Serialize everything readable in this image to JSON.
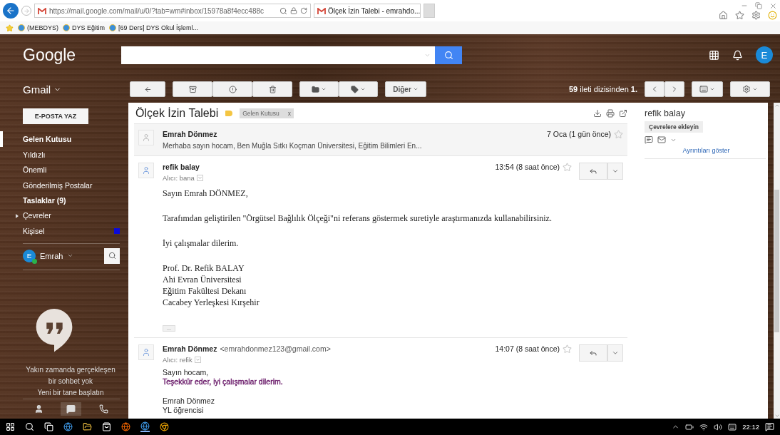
{
  "browser": {
    "url": "https://mail.google.com/mail/u/0/?tab=wm#inbox/15978a8f4ecc488c",
    "tab_title": "Ölçek İzin Talebi - emrahdo...",
    "favorites": [
      "(MEBDYS)",
      "DYS Eğitim",
      "[69 Ders] DYS Okul İşleml..."
    ]
  },
  "header": {
    "logo": "Google",
    "avatar": "E"
  },
  "toolbar": {
    "app_label": "Gmail",
    "more": "Diğer",
    "count": "**59** ileti dizisinden **1.**"
  },
  "sidebar": {
    "compose": "E-POSTA YAZ",
    "items": [
      {
        "label": "Gelen Kutusu",
        "selected": true,
        "bold": true,
        "kind": "folder"
      },
      {
        "label": "Yıldızlı",
        "selected": false,
        "bold": false,
        "kind": "folder"
      },
      {
        "label": "Önemli",
        "selected": false,
        "bold": false,
        "kind": "folder"
      },
      {
        "label": "Gönderilmiş Postalar",
        "selected": false,
        "bold": false,
        "kind": "folder"
      },
      {
        "label": "Taslaklar (9)",
        "selected": false,
        "bold": true,
        "kind": "folder"
      },
      {
        "label": "Çevreler",
        "selected": false,
        "bold": false,
        "kind": "group",
        "expanded": false
      },
      {
        "label": "Kişisel",
        "selected": false,
        "bold": false,
        "kind": "label",
        "color": "#0a0ad8"
      }
    ],
    "user": {
      "avatar": "E",
      "name": "Emrah",
      "online": true
    },
    "hangouts": [
      "Yakın zamanda gerçekleşen",
      "bir sohbet yok",
      "Yeni bir tane başlatın"
    ]
  },
  "thread": {
    "subject": "Ölçek İzin Talebi",
    "labels": [
      {
        "name": "Gelen Kutusu",
        "remove": "x"
      }
    ],
    "messages": [
      {
        "kind": "collapsed",
        "sender": "Emrah Dönmez",
        "date": "7 Oca (1 gün önce)",
        "starred": false,
        "snippet": "Merhaba sayın hocam, Ben Muğla Sıtkı Koçman Üniversitesi, Eğitim Bilimleri En..."
      },
      {
        "kind": "formatted",
        "sender": "refik balay",
        "recipient": "Alıcı: bana",
        "date": "13:54 (8 saat önce)",
        "starred": false,
        "trimmed": "...",
        "paragraphs": [
          {
            "lines": [
              {
                "text": "Sayın Emrah DÖNMEZ,"
              }
            ]
          },
          {
            "lines": [
              {
                "text": "Tarafımdan geliştirilen \"Örgütsel Bağlılık Ölçeği\"ni referans göstermek suretiyle araştırmanızda kullanabilirsiniz."
              }
            ]
          },
          {
            "lines": [
              {
                "text": "İyi çalışmalar dilerim."
              }
            ]
          },
          {
            "lines": [
              {
                "text": "Prof. Dr. Refik BALAY"
              },
              {
                "text": "Ahi Evran Üniversitesi"
              },
              {
                "text": "Eğitim Fakültesi Dekanı"
              },
              {
                "text": "Cacabey Yerleşkesi Kırşehir"
              }
            ]
          }
        ]
      },
      {
        "kind": "plain",
        "sender": "Emrah Dönmez",
        "email": "<emrahdonmez123@gmail.com>",
        "recipient": "Alıcı: refik",
        "date": "14:07 (8 saat önce)",
        "starred": false,
        "paragraphs": [
          {
            "lines": [
              {
                "text": "Sayın hocam,"
              },
              {
                "text": "Teşekkür eder, iyi çalışmalar dilerim.",
                "color": "#6a1b6a"
              }
            ]
          },
          {
            "lines": [
              {
                "text": "Emrah Dönmez"
              },
              {
                "text": "YL öğrencisi"
              }
            ]
          }
        ]
      }
    ]
  },
  "contact": {
    "name": "refik balay",
    "add": "Çevrelere ekleyin",
    "details": "Ayrıntıları göster"
  },
  "taskbar": {
    "time": "22:12"
  }
}
